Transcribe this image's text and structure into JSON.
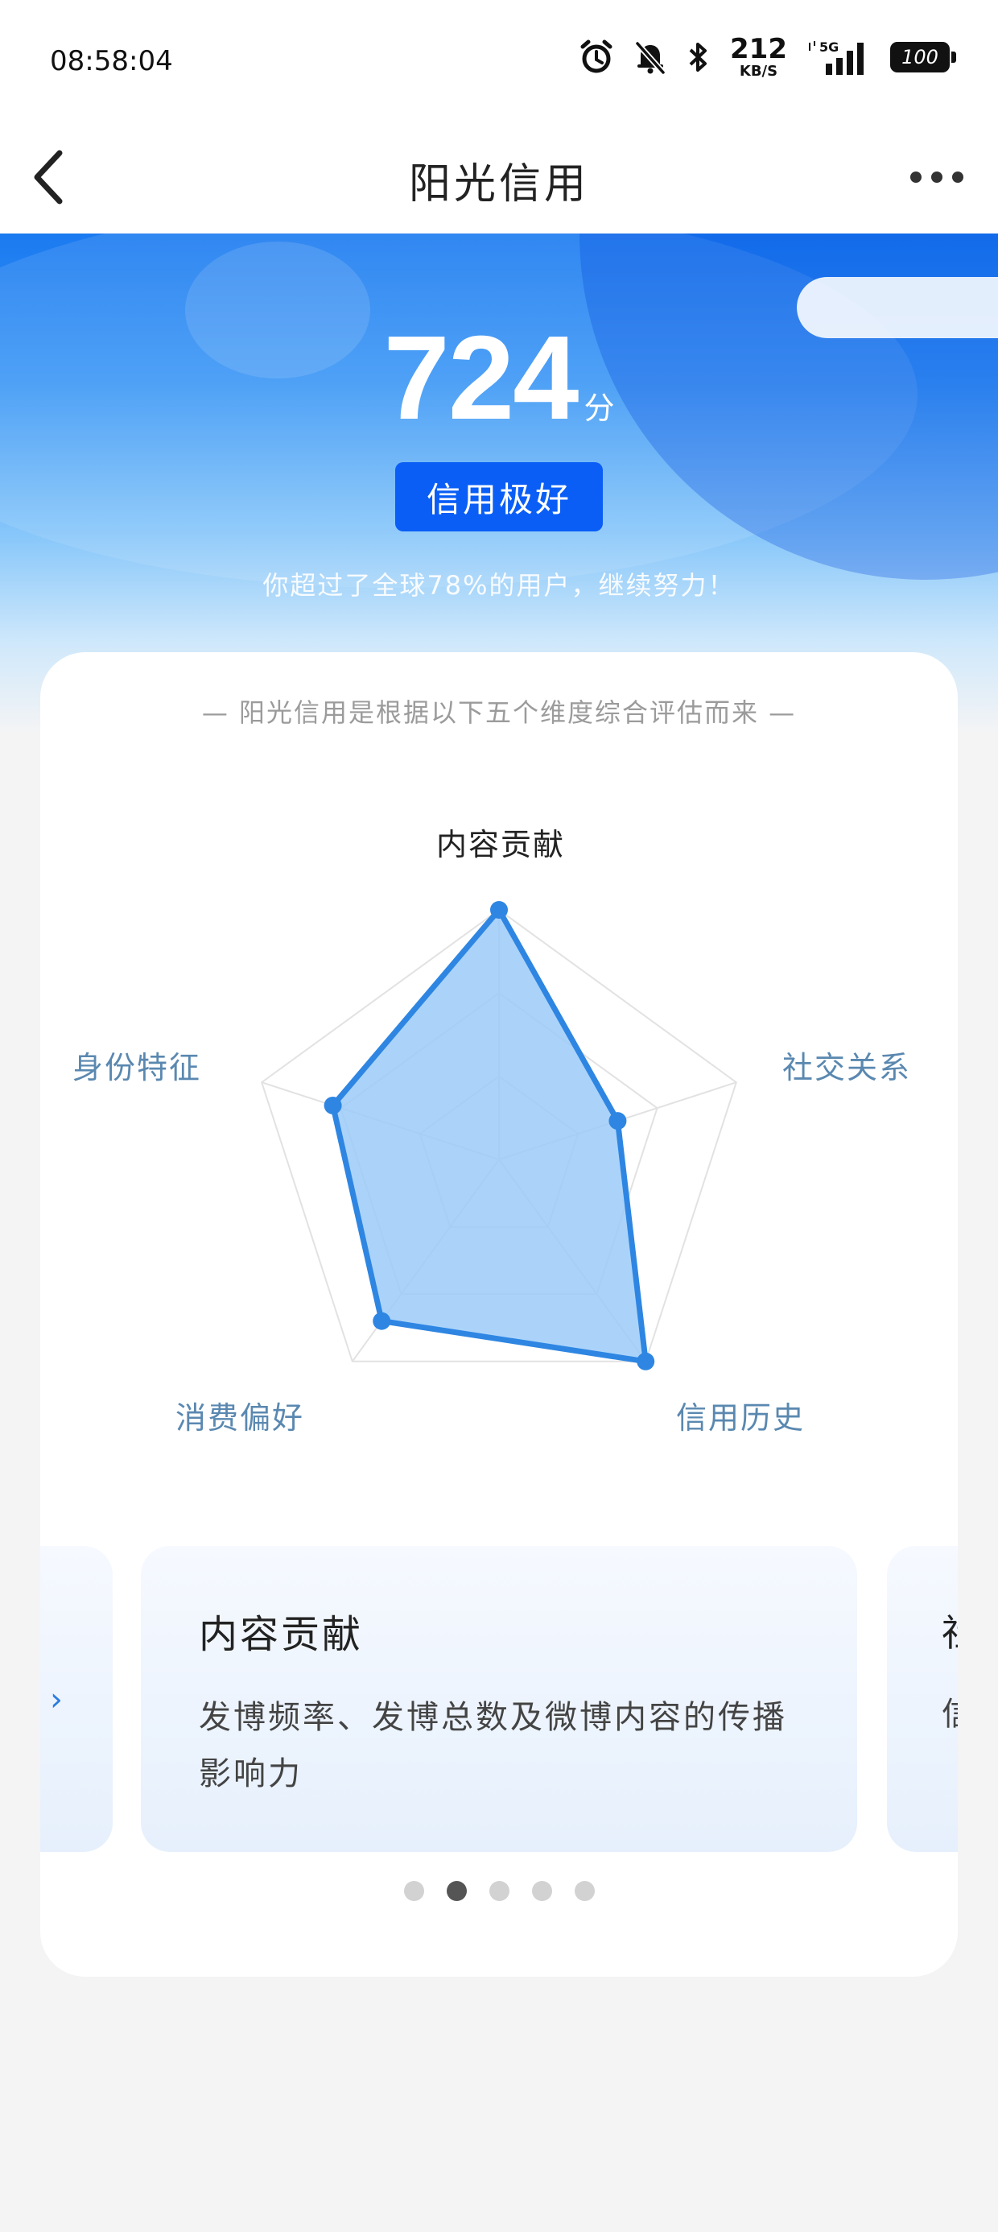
{
  "status_bar": {
    "time": "08:58:04",
    "speed_value": "212",
    "speed_unit": "KB/S",
    "network": "5G",
    "battery": "100",
    "icons": [
      "alarm-icon",
      "mute-bell-icon",
      "bluetooth-icon",
      "signal-icon",
      "battery-icon"
    ]
  },
  "nav": {
    "title": "阳光信用",
    "back_icon": "chevron-left-icon",
    "more_icon": "more-dots-icon"
  },
  "hero": {
    "score": "724",
    "score_unit": "分",
    "level": "信用极好",
    "subtitle": "你超过了全球78%的用户，继续努力！"
  },
  "card": {
    "caption": "— 阳光信用是根据以下五个维度综合评估而来 —"
  },
  "chart_data": {
    "type": "radar",
    "axes": [
      "内容贡献",
      "社交关系",
      "信用历史",
      "消费偏好",
      "身份特征"
    ],
    "values": [
      1.0,
      0.5,
      1.0,
      0.8,
      0.7
    ],
    "range": [
      0,
      1
    ],
    "rings": 3,
    "highlighted_axis": "内容贡献",
    "colors": {
      "fill": "#9ccbf8",
      "stroke": "#2e86e2",
      "grid": "#e2e2e2"
    }
  },
  "carousel": {
    "active_index": 1,
    "active_slide": {
      "title": "内容贡献",
      "description": "发博频率、发博总数及微博内容的传播影响力"
    },
    "next_peek_title": "社",
    "next_peek_desc": "信",
    "dot_count": 5
  },
  "colors": {
    "primary": "#0a5ef6",
    "accent": "#2e86e2"
  }
}
